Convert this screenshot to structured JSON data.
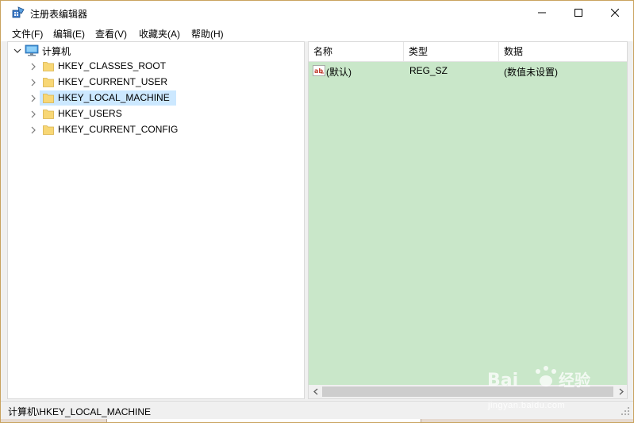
{
  "window": {
    "title": "注册表编辑器"
  },
  "menu": {
    "items": [
      {
        "label": "文件(F)"
      },
      {
        "label": "编辑(E)"
      },
      {
        "label": "查看(V)"
      },
      {
        "label": "收藏夹(A)"
      },
      {
        "label": "帮助(H)"
      }
    ]
  },
  "tree": {
    "root": {
      "label": "计算机",
      "expanded": true,
      "icon": "computer-icon"
    },
    "children": [
      {
        "label": "HKEY_CLASSES_ROOT",
        "selected": false,
        "icon": "folder-icon"
      },
      {
        "label": "HKEY_CURRENT_USER",
        "selected": false,
        "icon": "folder-icon"
      },
      {
        "label": "HKEY_LOCAL_MACHINE",
        "selected": true,
        "icon": "folder-icon"
      },
      {
        "label": "HKEY_USERS",
        "selected": false,
        "icon": "folder-icon"
      },
      {
        "label": "HKEY_CURRENT_CONFIG",
        "selected": false,
        "icon": "folder-icon"
      }
    ]
  },
  "list": {
    "columns": [
      {
        "label": "名称"
      },
      {
        "label": "类型"
      },
      {
        "label": "数据"
      }
    ],
    "rows": [
      {
        "name": "(默认)",
        "type": "REG_SZ",
        "data": "(数值未设置)",
        "icon": "string-value-icon"
      }
    ],
    "background_color": "#c9e7c9"
  },
  "status": {
    "path": "计算机\\HKEY_LOCAL_MACHINE"
  },
  "colors": {
    "selection": "#cce8ff",
    "window_border": "#c9a35f"
  },
  "watermark": {
    "text": "jingyan.baidu.com",
    "logo": "Baidu 经验"
  }
}
